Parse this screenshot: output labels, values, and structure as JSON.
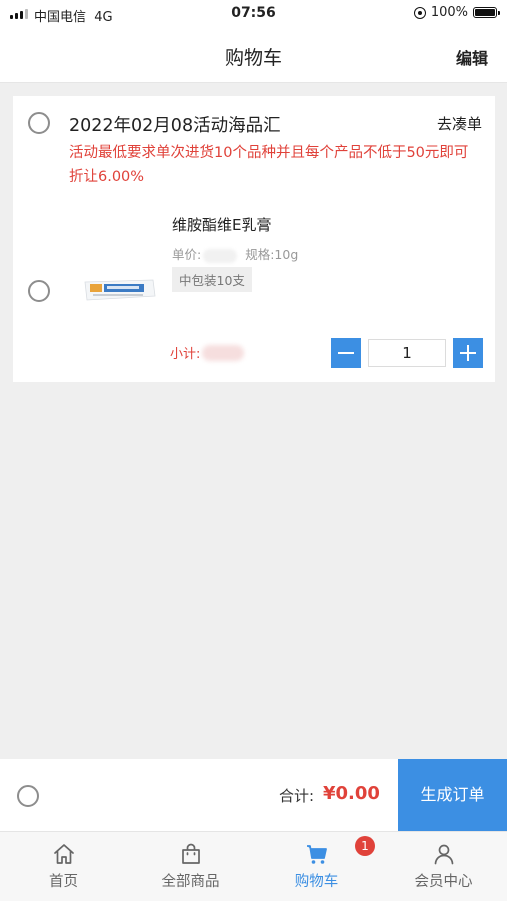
{
  "status_bar": {
    "carrier": "中国电信",
    "network": "4G",
    "time": "07:56",
    "battery": "100%",
    "battery_level": 1.0
  },
  "header": {
    "title": "购物车",
    "edit_label": "编辑"
  },
  "promotion": {
    "title": "2022年02月08活动海品汇",
    "link_label": "去凑单",
    "description": "活动最低要求单次进货10个品种并且每个产品不低于50元即可折让6.00%"
  },
  "product": {
    "name": "维胺酯维E乳膏",
    "price_label": "单价:",
    "spec": "规格:10g",
    "package": "中包装10支",
    "subtotal_label": "小计:",
    "quantity": "1"
  },
  "footer": {
    "total_label": "合计:",
    "total_amount": "¥0.00",
    "checkout_label": "生成订单"
  },
  "tabbar": {
    "items": [
      {
        "label": "首页"
      },
      {
        "label": "全部商品"
      },
      {
        "label": "购物车"
      },
      {
        "label": "会员中心"
      }
    ],
    "cart_badge": "1"
  },
  "colors": {
    "accent": "#3c8fe3",
    "promo_red": "#e0423a"
  }
}
